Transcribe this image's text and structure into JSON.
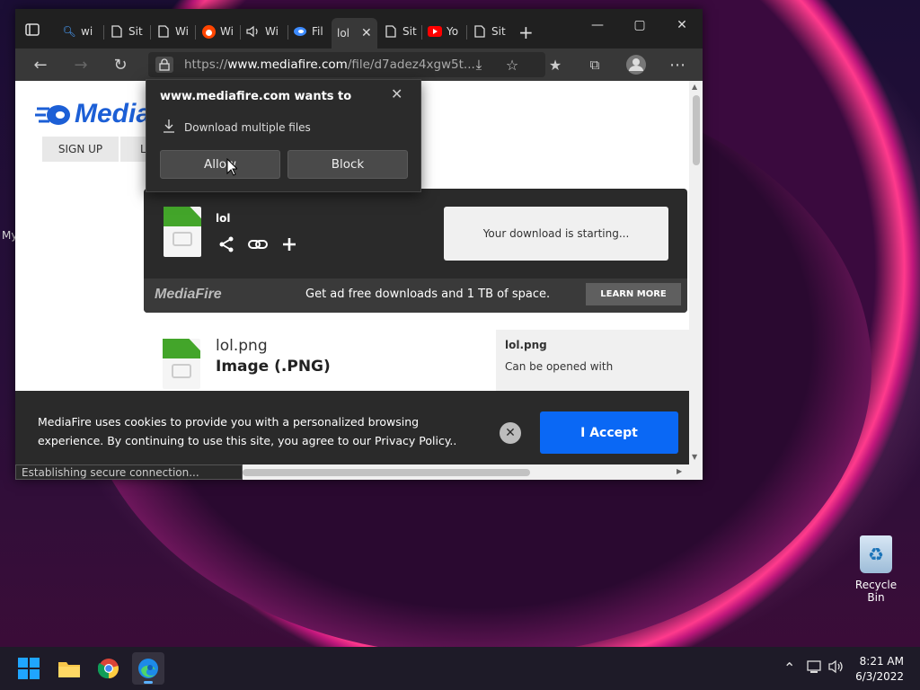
{
  "desktop": {
    "partial_label": "My",
    "recycle_bin_label": "Recycle Bin"
  },
  "browser": {
    "tabs": [
      {
        "label": "wi",
        "icon": "search-icon"
      },
      {
        "label": "Sit",
        "icon": "page-icon"
      },
      {
        "label": "Wi",
        "icon": "page-icon"
      },
      {
        "label": "Wi",
        "icon": "reddit-icon"
      },
      {
        "label": "Wi",
        "icon": "speaker-icon"
      },
      {
        "label": "Fil",
        "icon": "mediafire-icon"
      },
      {
        "label": "lol",
        "icon": "page-icon",
        "active": true
      },
      {
        "label": "Sit",
        "icon": "page-icon"
      },
      {
        "label": "Yo",
        "icon": "youtube-icon"
      },
      {
        "label": "Sit",
        "icon": "page-icon"
      }
    ],
    "address": {
      "prefix": "https://",
      "domain": "www.mediafire.com",
      "path": "/file/d7adez4xgw5t..."
    },
    "status_text": "Establishing secure connection..."
  },
  "popup": {
    "title": "www.mediafire.com wants to",
    "permission": "Download multiple files",
    "allow_label": "Allow",
    "block_label": "Block"
  },
  "page": {
    "logo_text": "Media",
    "nav_signup": "SIGN UP",
    "nav_second": "L",
    "download_file_name": "lol",
    "download_status": "Your download is starting...",
    "banner_logo": "MediaFire",
    "banner_text": "Get ad free downloads and 1 TB of space.",
    "learn_more": "LEARN MORE",
    "file_name": "lol.png",
    "file_type": "Image (.PNG)",
    "side_title": "lol.png",
    "side_text": "Can be opened with",
    "cookie_text": "MediaFire uses cookies to provide you with a personalized browsing experience. By continuing to use this site, you agree to our Privacy Policy..",
    "accept_label": "I Accept"
  },
  "taskbar": {
    "apps": [
      "start-icon",
      "file-explorer-icon",
      "chrome-icon",
      "edge-icon"
    ],
    "time": "8:21 AM",
    "date": "6/3/2022"
  },
  "colors": {
    "accept_blue": "#0a68f5",
    "mediafire_blue": "#1c5fd6",
    "file_green": "#43a52a"
  }
}
